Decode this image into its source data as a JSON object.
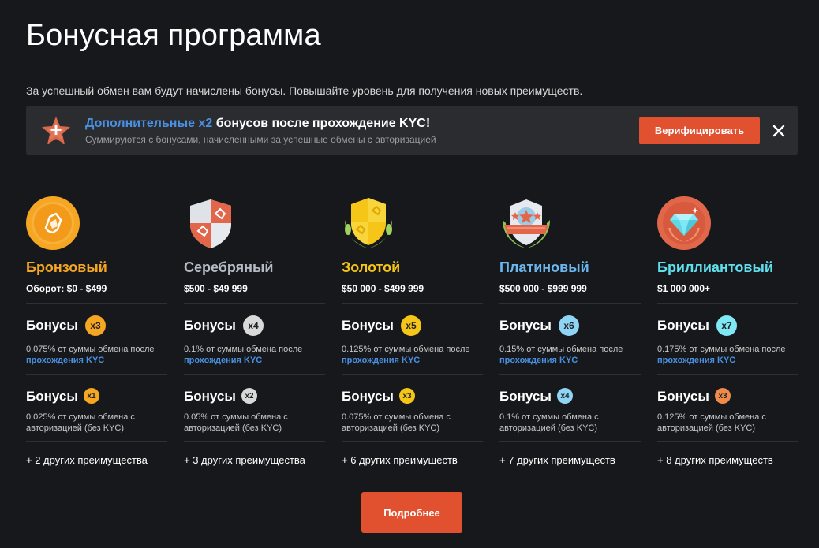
{
  "page": {
    "title": "Бонусная программа",
    "subtitle": "За успешный обмен вам будут начислены бонусы. Повышайте уровень для получения новых преимуществ."
  },
  "kyc_banner": {
    "title_accent": "Дополнительные x2",
    "title_rest": " бонусов после прохождение KYC!",
    "subtitle": "Суммируются с бонусами, начисленными за успешные обмены с авторизацией",
    "verify_label": "Верифицировать",
    "icon": "star-plus-icon",
    "close_icon": "close-icon"
  },
  "bonus_label": "Бонусы",
  "levels": [
    {
      "name": "Бронзовый",
      "color": "#f5a623",
      "range": "Оборот: $0 - $499",
      "icon": "bronze-medal-icon",
      "kyc_bonus": {
        "badge": "x3",
        "badge_color": "#f5a623",
        "desc": "0.075% от суммы обмена после ",
        "link": "прохождения KYC"
      },
      "auth_bonus": {
        "badge": "x1",
        "badge_color": "#f5a623",
        "desc": "0.025% от суммы обмена с авторизацией (без KYC)"
      },
      "more": "+ 2 других преимущества"
    },
    {
      "name": "Серебряный",
      "color": "#b5bcc6",
      "range": "$500 - $49 999",
      "icon": "silver-shield-icon",
      "kyc_bonus": {
        "badge": "x4",
        "badge_color": "#d9d9d9",
        "desc": "0.1% от суммы обмена после ",
        "link": "прохождения KYC"
      },
      "auth_bonus": {
        "badge": "x2",
        "badge_color": "#d9d9d9",
        "desc": "0.05% от суммы обмена с авторизацией (без KYC)"
      },
      "more": "+ 3 других преимущества"
    },
    {
      "name": "Золотой",
      "color": "#f5c518",
      "range": "$50 000 - $499 999",
      "icon": "gold-shield-icon",
      "kyc_bonus": {
        "badge": "x5",
        "badge_color": "#f5c518",
        "desc": "0.125% от суммы обмена после ",
        "link": "прохождения KYC"
      },
      "auth_bonus": {
        "badge": "x3",
        "badge_color": "#f5c518",
        "desc": "0.075% от суммы обмена с авторизацией (без KYC)"
      },
      "more": "+ 6 других преимуществ"
    },
    {
      "name": "Платиновый",
      "color": "#6bb7f0",
      "range": "$500 000 - $999 999",
      "icon": "platinum-badge-icon",
      "kyc_bonus": {
        "badge": "x6",
        "badge_color": "#8fd3f5",
        "desc": "0.15% от суммы обмена после ",
        "link": "прохождения KYC"
      },
      "auth_bonus": {
        "badge": "x4",
        "badge_color": "#8fd3f5",
        "desc": "0.1% от суммы обмена с авторизацией (без KYC)"
      },
      "more": "+ 7 других преимуществ"
    },
    {
      "name": "Бриллиантовый",
      "color": "#5fe0ee",
      "range": "$1 000 000+",
      "icon": "diamond-medal-icon",
      "kyc_bonus": {
        "badge": "x7",
        "badge_color": "#7ee8f5",
        "desc": "0.175% от суммы обмена после ",
        "link": "прохождения KYC"
      },
      "auth_bonus": {
        "badge": "x3",
        "badge_color": "#f08a4b",
        "desc": "0.125% от суммы обмена с авторизацией (без KYC)"
      },
      "more": "+ 8 других преимуществ"
    }
  ],
  "details_button": "Подробнее"
}
